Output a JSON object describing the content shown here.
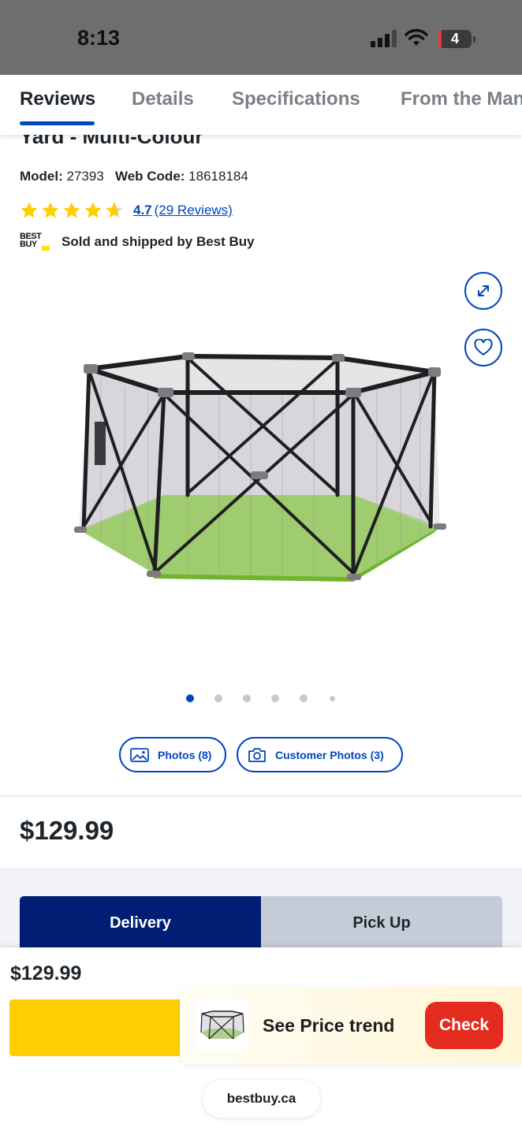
{
  "status_bar": {
    "time": "8:13",
    "battery": "4"
  },
  "tabs": [
    {
      "label": "Reviews",
      "active": true
    },
    {
      "label": "Details",
      "active": false
    },
    {
      "label": "Specifications",
      "active": false
    },
    {
      "label": "From the Man",
      "active": false
    }
  ],
  "product": {
    "partial_title": "Yard - Multi-Colour",
    "model_label": "Model:",
    "model_value": "27393",
    "web_code_label": "Web Code:",
    "web_code_value": "18618184",
    "rating": "4.7",
    "review_count": "(29 Reviews)",
    "star_fill": 4.7,
    "star_color": "#ffce00",
    "seller_logo": "BEST BUY",
    "seller_text": "Sold and shipped by Best Buy",
    "image_icon": "hexagonal-playpen-image",
    "carousel_active_index": 0,
    "carousel_count": 6
  },
  "media_buttons": {
    "photos": "Photos (8)",
    "customer_photos": "Customer Photos (3)"
  },
  "price": "$129.99",
  "fulfillment": {
    "delivery": "Delivery",
    "pickup": "Pick Up"
  },
  "sticky": {
    "price": "$129.99"
  },
  "price_trend": {
    "text": "See Price trend",
    "button": "Check"
  },
  "browser": {
    "url": "bestbuy.ca"
  },
  "colors": {
    "accent_blue": "#0046be",
    "delivery_navy": "#001e73",
    "cta_yellow": "#ffce00",
    "check_red": "#e32b1e"
  }
}
